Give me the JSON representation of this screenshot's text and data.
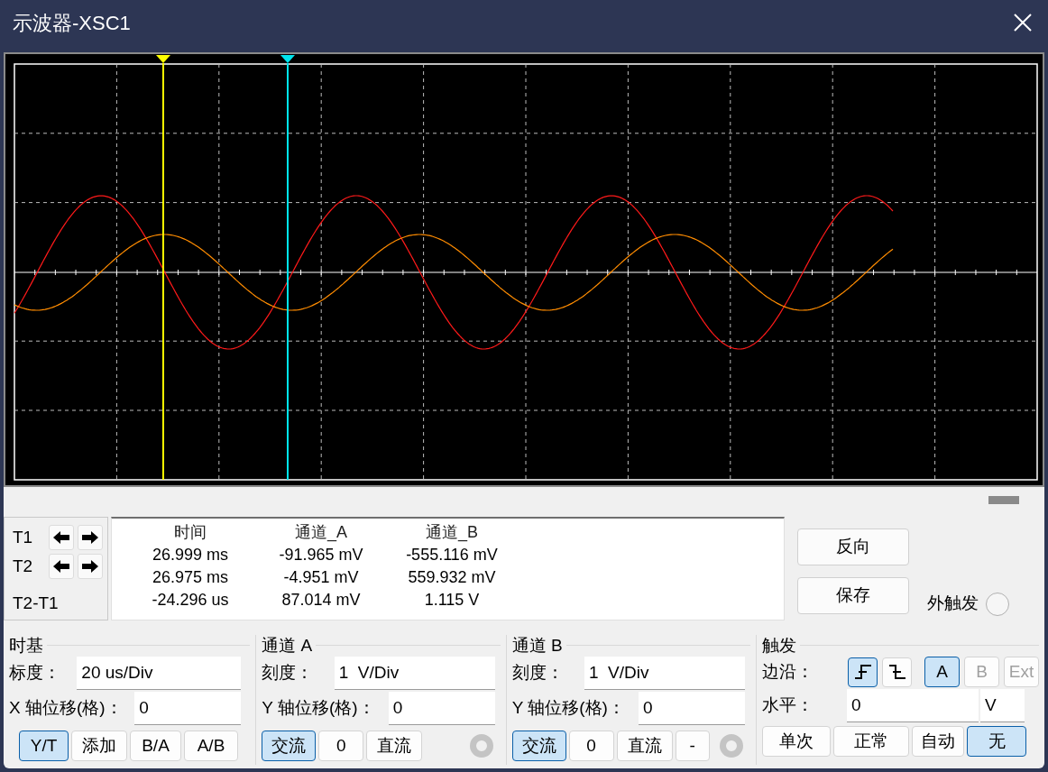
{
  "window": {
    "title": "示波器-XSC1"
  },
  "cursors": [
    {
      "color": "#ffff00"
    },
    {
      "color": "#00e5ee"
    }
  ],
  "readout": {
    "columns": [
      "时间",
      "通道_A",
      "通道_B"
    ],
    "rows": [
      {
        "label": "T1",
        "arrows": true,
        "values": [
          "26.999 ms",
          "-91.965 mV",
          "-555.116 mV"
        ]
      },
      {
        "label": "T2",
        "arrows": true,
        "values": [
          "26.975 ms",
          "-4.951 mV",
          "559.932 mV"
        ]
      },
      {
        "label": "T2-T1",
        "arrows": false,
        "values": [
          "-24.296 us",
          "87.014 mV",
          "1.115 V"
        ]
      }
    ]
  },
  "buttons": [
    "反向",
    "保存"
  ],
  "external_trigger": {
    "label": "外触发",
    "selected": false
  },
  "timebase": {
    "title": "时基",
    "scale": {
      "label": "标度：",
      "value": "20 us/Div"
    },
    "offset": {
      "label": "X 轴位移(格)：",
      "value": "0"
    },
    "modes": [
      {
        "label": "Y/T",
        "selected": true
      },
      {
        "label": "添加",
        "selected": false
      },
      {
        "label": "B/A",
        "selected": false
      },
      {
        "label": "A/B",
        "selected": false
      }
    ]
  },
  "channels": [
    {
      "title": "通道 A",
      "scale": {
        "label": "刻度：",
        "value": "1  V/Div"
      },
      "offset": {
        "label": "Y 轴位移(格)：",
        "value": "0"
      },
      "coupling": [
        {
          "label": "交流",
          "selected": true
        },
        {
          "label": "0",
          "selected": false
        },
        {
          "label": "直流",
          "selected": false
        }
      ]
    },
    {
      "title": "通道 B",
      "scale": {
        "label": "刻度：",
        "value": "1  V/Div"
      },
      "offset": {
        "label": "Y 轴位移(格)：",
        "value": "0"
      },
      "coupling": [
        {
          "label": "交流",
          "selected": true
        },
        {
          "label": "0",
          "selected": false
        },
        {
          "label": "直流",
          "selected": false
        },
        {
          "label": "-",
          "selected": false
        }
      ]
    }
  ],
  "trigger": {
    "title": "触发",
    "edge_label": "边沿：",
    "edges": [
      {
        "kind": "rising",
        "selected": true
      },
      {
        "kind": "falling",
        "selected": false
      }
    ],
    "sources": [
      {
        "label": "A",
        "selected": true,
        "disabled": false
      },
      {
        "label": "B",
        "selected": false,
        "disabled": true
      },
      {
        "label": "Ext",
        "selected": false,
        "disabled": true
      }
    ],
    "level": {
      "label": "水平：",
      "value": "0",
      "unit": "V"
    },
    "modes": [
      {
        "label": "单次",
        "selected": false
      },
      {
        "label": "正常",
        "selected": false
      },
      {
        "label": "自动",
        "selected": false
      },
      {
        "label": "无",
        "selected": true
      }
    ]
  }
}
